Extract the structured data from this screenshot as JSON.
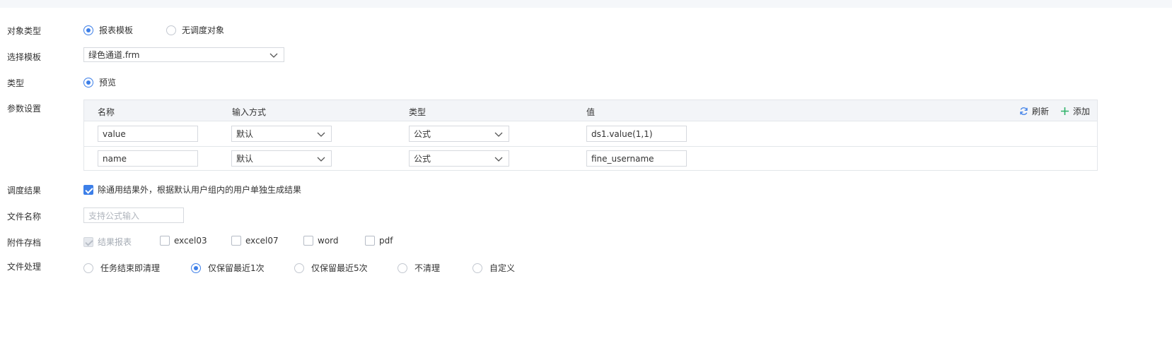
{
  "form": {
    "object_type": {
      "label": "对象类型",
      "options": [
        {
          "label": "报表模板",
          "selected": true
        },
        {
          "label": "无调度对象",
          "selected": false
        }
      ]
    },
    "template": {
      "label": "选择模板",
      "value": "绿色通道.frm"
    },
    "type": {
      "label": "类型",
      "options": [
        {
          "label": "预览",
          "selected": true
        }
      ]
    },
    "params": {
      "label": "参数设置",
      "columns": [
        "名称",
        "输入方式",
        "类型",
        "值"
      ],
      "refresh_label": "刷新",
      "add_label": "添加",
      "rows": [
        {
          "name": "value",
          "input_method": "默认",
          "type": "公式",
          "value": "ds1.value(1,1)"
        },
        {
          "name": "name",
          "input_method": "默认",
          "type": "公式",
          "value": "fine_username"
        }
      ]
    },
    "result": {
      "label": "调度结果",
      "checkbox_label": "除通用结果外，根据默认用户组内的用户单独生成结果",
      "checked": true
    },
    "filename": {
      "label": "文件名称",
      "placeholder": "支持公式输入"
    },
    "attachments": {
      "label": "附件存档",
      "options": [
        {
          "label": "结果报表",
          "checked": true,
          "disabled": true
        },
        {
          "label": "excel03",
          "checked": false
        },
        {
          "label": "excel07",
          "checked": false
        },
        {
          "label": "word",
          "checked": false
        },
        {
          "label": "pdf",
          "checked": false
        }
      ]
    },
    "file_handling": {
      "label": "文件处理",
      "options": [
        {
          "label": "任务结束即清理",
          "selected": false
        },
        {
          "label": "仅保留最近1次",
          "selected": true
        },
        {
          "label": "仅保留最近5次",
          "selected": false
        },
        {
          "label": "不清理",
          "selected": false
        },
        {
          "label": "自定义",
          "selected": false
        }
      ]
    }
  },
  "colors": {
    "accent": "#3d7fe8",
    "add_icon": "#2fb36a",
    "border": "#d6d9de",
    "header_bg": "#f3f5f8"
  }
}
